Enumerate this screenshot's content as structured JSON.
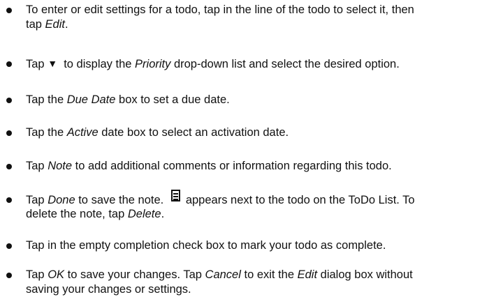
{
  "items": [
    {
      "line1_a": "To enter or edit settings for a todo, tap in the line of the todo to select it, then",
      "line2_a": "tap ",
      "line2_em": "Edit",
      "line2_b": "."
    },
    {
      "a": "Tap ",
      "arrow": "▼",
      "b": "  to display the ",
      "em": "Priority",
      "c": " drop-down list and select the desired option."
    },
    {
      "a": "Tap the ",
      "em": "Due Date",
      "b": " box to set a due date."
    },
    {
      "a": "Tap the ",
      "em": "Active",
      "b": " date box to select an activation date."
    },
    {
      "a": "Tap ",
      "em": "Note",
      "b": " to add additional comments or information regarding this todo."
    },
    {
      "a": "Tap ",
      "em": "Done",
      "b": " to save the note. ",
      "icon": "note-icon",
      "c": "appears next to the todo on the ToDo List. To",
      "line2_a": "delete the note, tap ",
      "line2_em": "Delete",
      "line2_b": "."
    },
    {
      "text": "Tap in the empty completion check box to mark your todo as complete."
    },
    {
      "a": "Tap ",
      "em1": "OK",
      "b": " to save your changes. Tap ",
      "em2": "Cancel",
      "c": " to exit the ",
      "em3": "Edit",
      "d": " dialog box without",
      "line2": "saving your changes or settings."
    }
  ]
}
